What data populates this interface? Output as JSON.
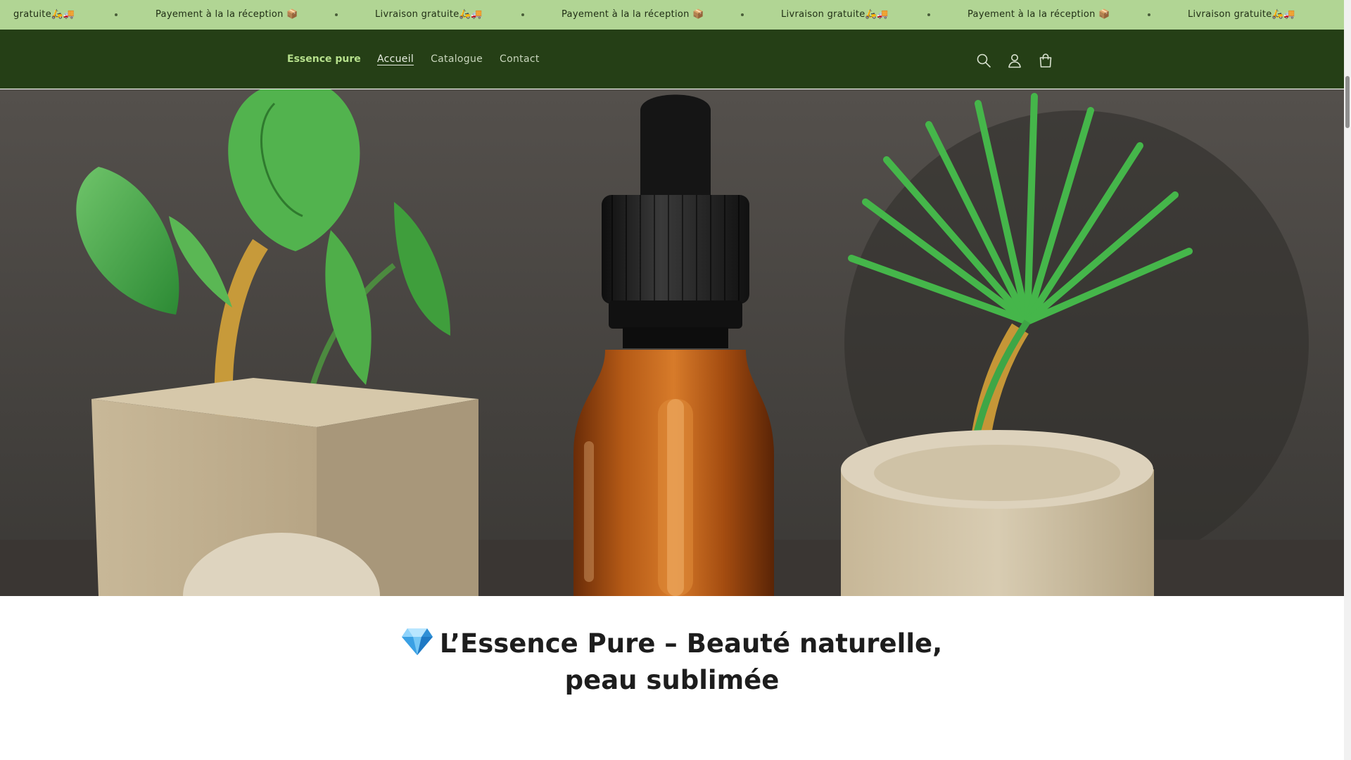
{
  "announcement": {
    "items": [
      "gratuite🛵🚚",
      "Payement à la la réception 📦",
      "Livraison gratuite🛵🚚",
      "Payement à la la réception 📦",
      "Livraison gratuite🛵🚚",
      "Payement à la la réception 📦",
      "Livraison gratuite🛵🚚"
    ]
  },
  "header": {
    "logo": "Essence pure",
    "nav": [
      "Accueil",
      "Catalogue",
      "Contact"
    ],
    "active_nav": "Accueil"
  },
  "icons": {
    "search": "search-icon",
    "account": "account-icon",
    "cart": "cart-icon"
  },
  "colors": {
    "announcement_bg": "#b1d594",
    "header_bg": "#253f16",
    "logo": "#b6e08c"
  },
  "intro": {
    "title_line1": "L’Essence Pure – Beauté naturelle,",
    "title_line2": "peau sublimée"
  }
}
